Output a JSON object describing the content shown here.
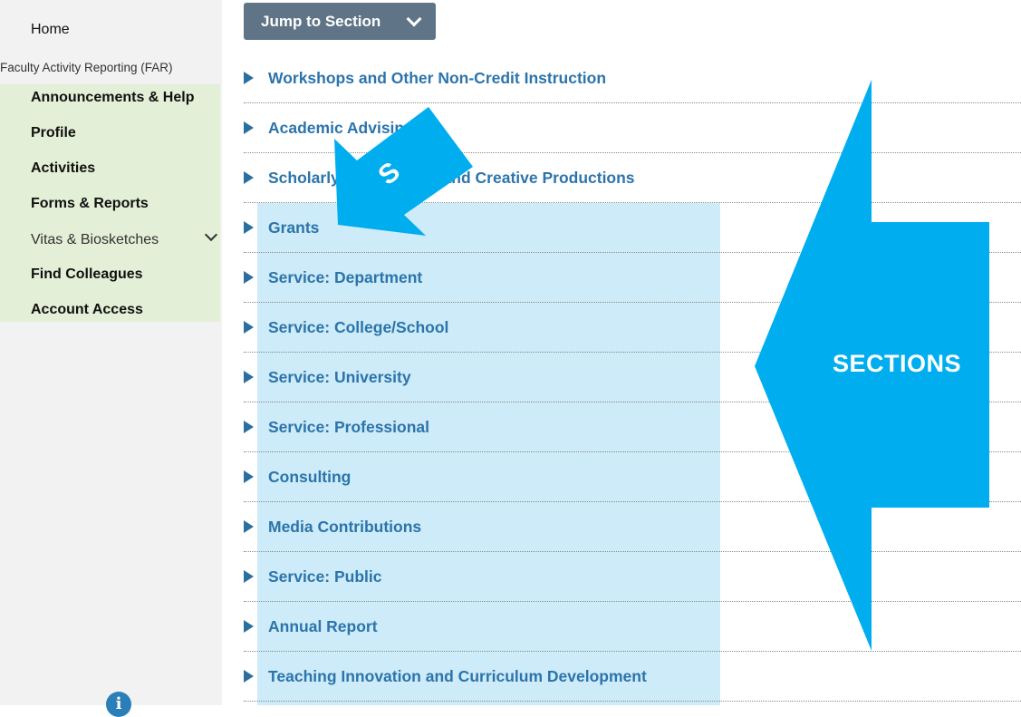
{
  "sidebar": {
    "home": "Home",
    "far": "Faculty Activity Reporting (FAR)",
    "items": [
      {
        "label": "Announcements & Help"
      },
      {
        "label": "Profile"
      },
      {
        "label": "Activities"
      },
      {
        "label": "Forms & Reports"
      },
      {
        "label": "Vitas & Biosketches"
      },
      {
        "label": "Find Colleagues"
      },
      {
        "label": "Account Access"
      }
    ],
    "info_icon": "i"
  },
  "jump_button": {
    "label": "Jump to Section"
  },
  "sections": [
    "Workshops and Other Non-Credit Instruction",
    "Academic Advising",
    "Scholarly Publications and Creative Productions",
    "Grants",
    "Service: Department",
    "Service: College/School",
    "Service: University",
    "Service: Professional",
    "Consulting",
    "Media Contributions",
    "Service: Public",
    "Annual Report",
    "Teaching Innovation and Curriculum Development"
  ],
  "annotations": {
    "big_arrow_label": "SECTIONS",
    "small_arrow_label": "S",
    "arrow_color": "#00aeef",
    "highlight_color": "#cdebf8"
  }
}
